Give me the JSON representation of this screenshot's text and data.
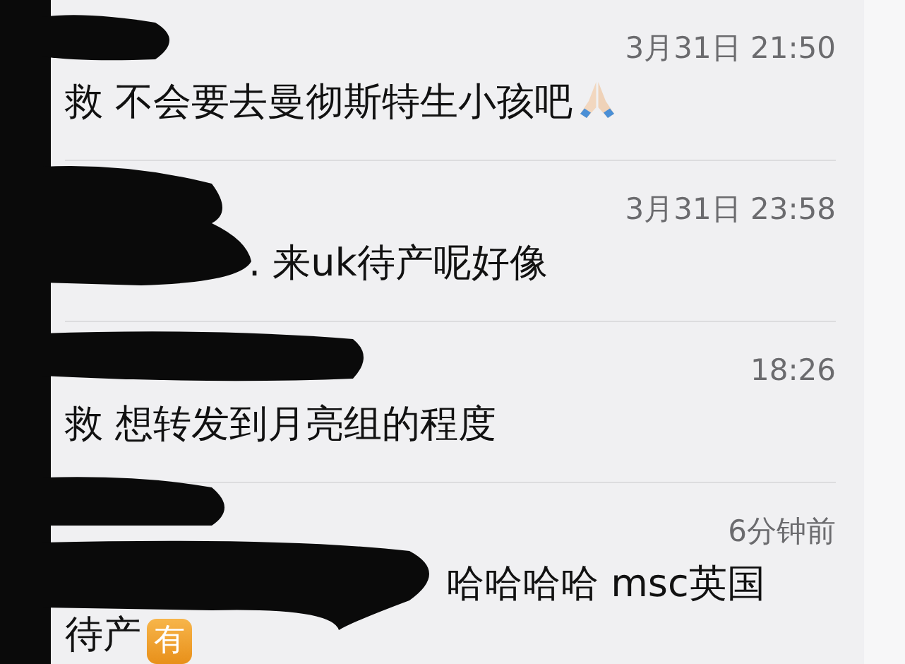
{
  "comments": [
    {
      "time": "3月31日 21:50",
      "lines": [
        "救 不会要去曼彻斯特生小孩吧"
      ],
      "kind": "emoji"
    },
    {
      "time": "3月31日 23:58",
      "lines": [
        ". 来uk待产呢好像"
      ],
      "kind": "plain"
    },
    {
      "time": "18:26",
      "lines": [
        "救 想转发到月亮组的程度"
      ],
      "kind": "plain"
    },
    {
      "time": "6分钟前",
      "lines": [
        "哈哈哈哈 msc英国",
        "待产"
      ],
      "kind": "badge",
      "badge": "有"
    }
  ]
}
